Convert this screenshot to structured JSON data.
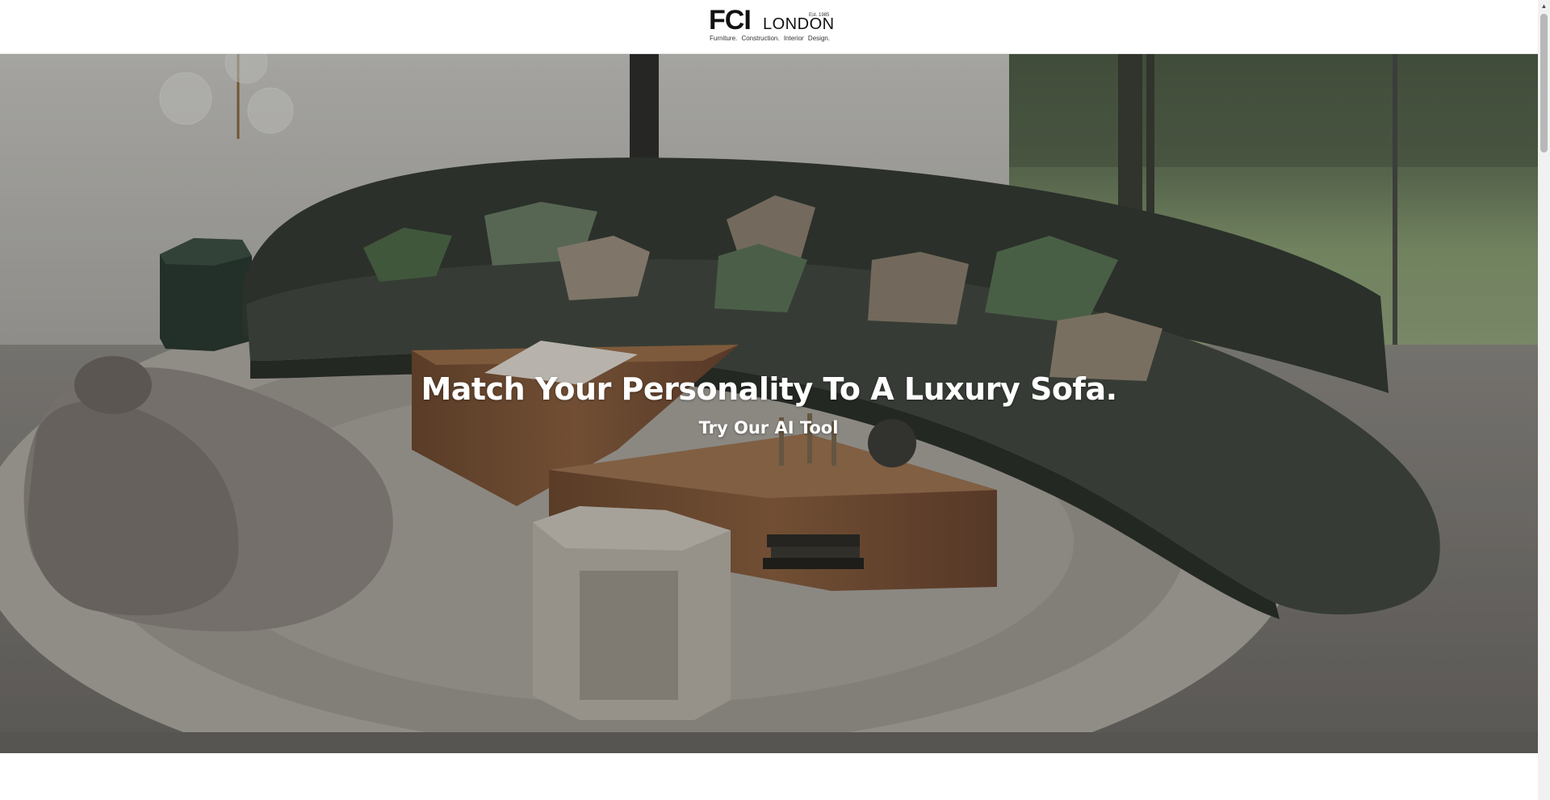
{
  "header": {
    "logo": {
      "brand": "FCI",
      "city": "LONDON",
      "established": "Est. 1985",
      "tagline": "Furniture.  Construction.  Interior Design."
    }
  },
  "hero": {
    "title": "Match Your Personality To A Luxury Sofa.",
    "cta_label": "Try Our AI Tool",
    "image_description": "living-room-curved-sofa-photo"
  },
  "scrollbar": {
    "up_icon": "triangle-up-icon"
  },
  "colors": {
    "sofa_green": "#3a4038",
    "wood": "#7a5236",
    "rug": "#a8a49c",
    "text": "#ffffff"
  }
}
